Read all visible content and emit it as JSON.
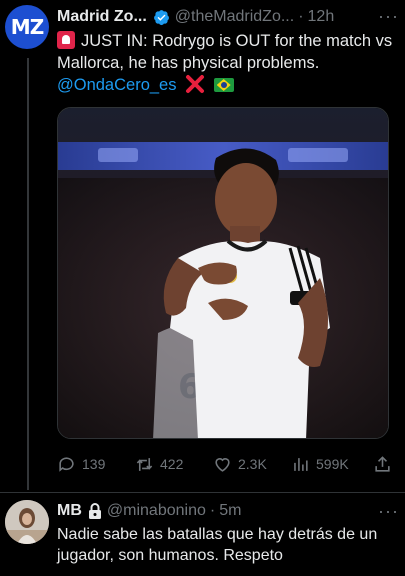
{
  "tweet": {
    "author": {
      "avatar_text": "MZ",
      "display_name": "Madrid Zo...",
      "handle": "@theMadridZo...",
      "separator": "·",
      "time": "12h",
      "more": "···",
      "avatar_color": "#1d4fd1",
      "verified_color": "#1d9bf0"
    },
    "text": {
      "emoji": "siren-icon",
      "line": "JUST IN: Rodrygo is OUT for the match vs Mallorca, he has physical problems.",
      "mention": "@OndaCero_es",
      "trailing_emojis": [
        "cross-mark-icon",
        "brazil-flag-icon"
      ]
    },
    "media": {
      "description_icon": "photo-rodrygo"
    },
    "actions": {
      "replies": "139",
      "retweets": "422",
      "likes": "2.3K",
      "views": "599K"
    }
  },
  "reply": {
    "display_name": "MB",
    "protected_icon": "lock-icon",
    "handle": "@minabonino",
    "separator": "·",
    "time": "5m",
    "more": "···",
    "text": "Nadie sabe las batallas que hay detrás de un jugador, son humanos. Respeto"
  },
  "colors": {
    "background": "#000000",
    "text": "#e7e9ea",
    "muted": "#71767b",
    "link": "#1d9bf0",
    "divider": "#2f3336"
  }
}
